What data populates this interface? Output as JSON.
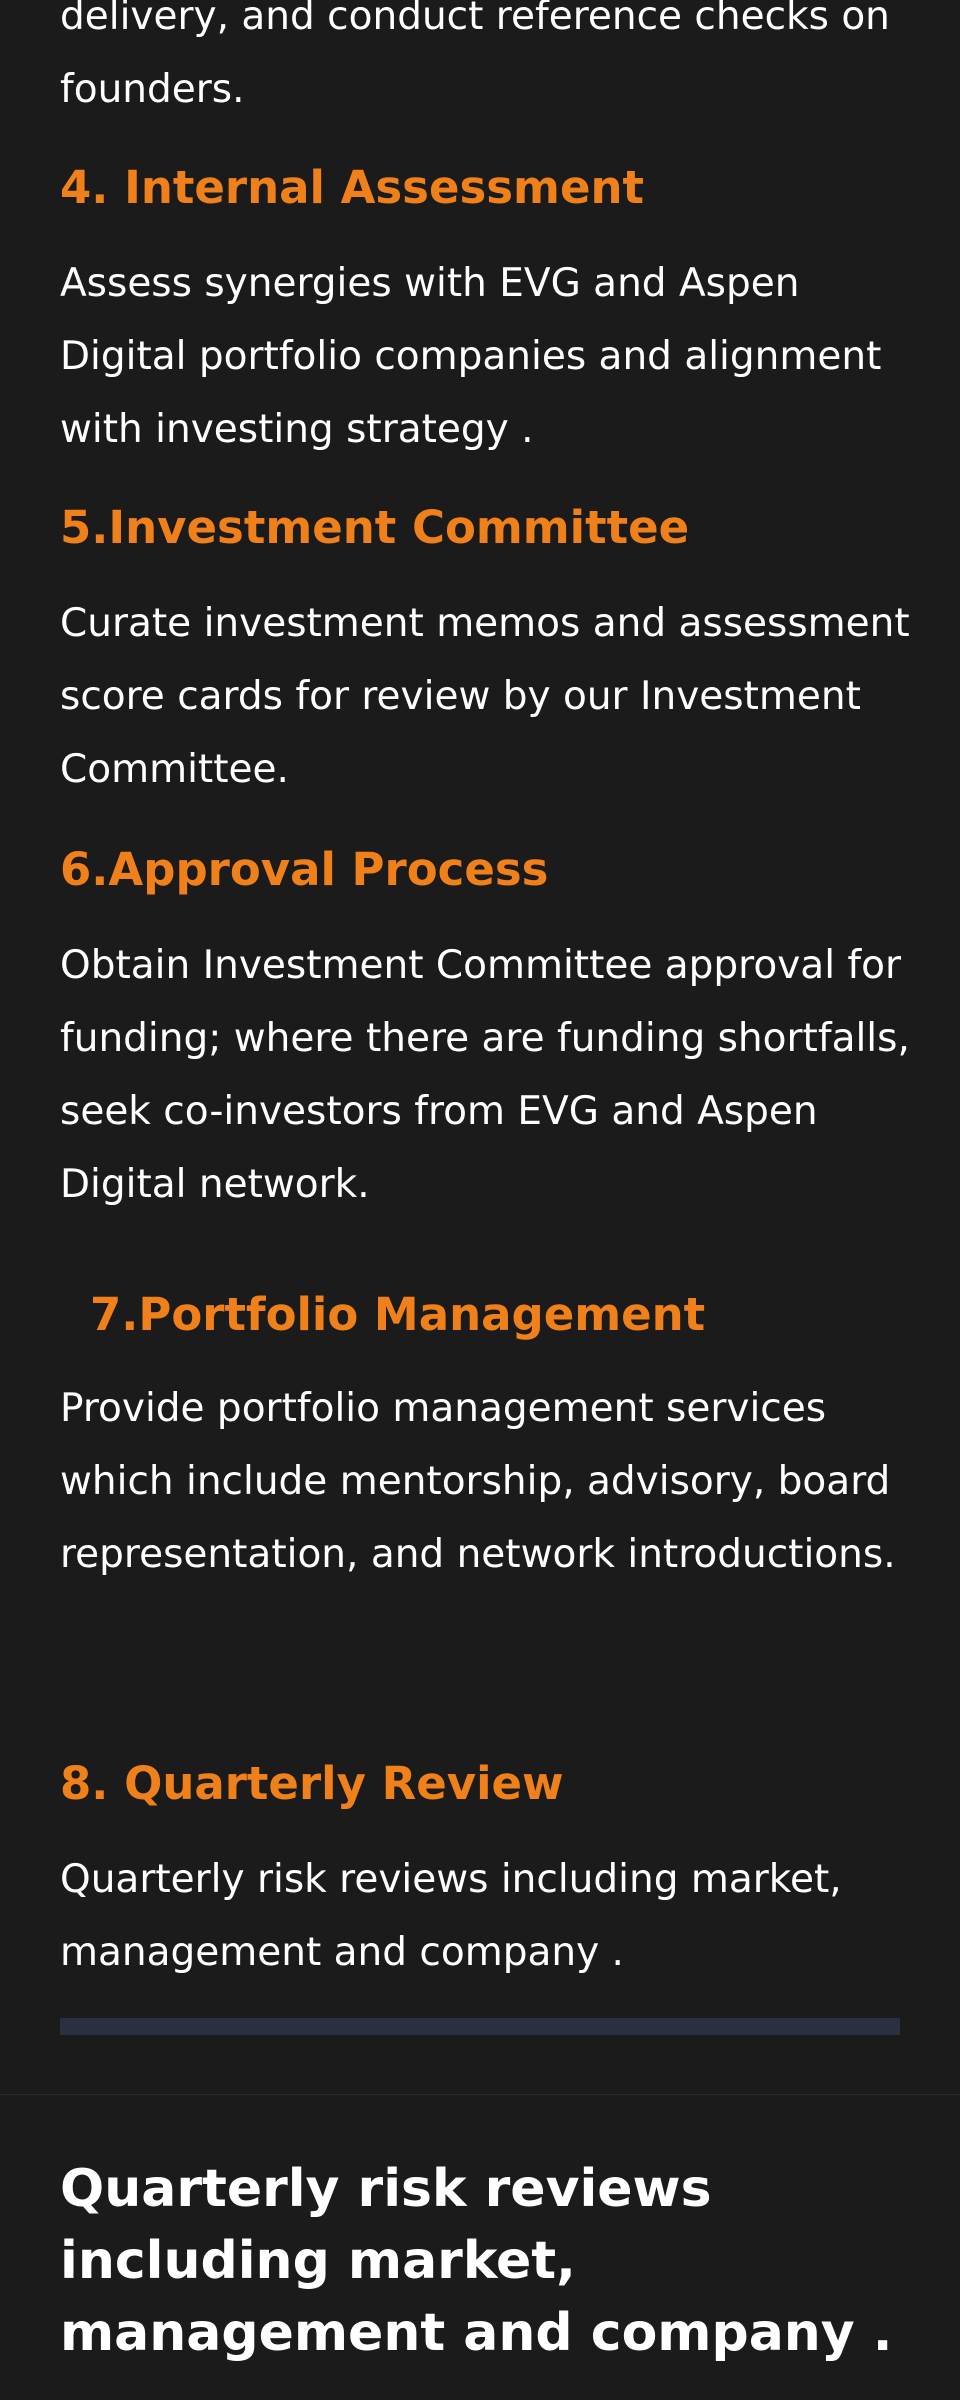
{
  "s3": {
    "tail_text": "delivery, and conduct reference checks on founders."
  },
  "s4": {
    "heading": "4. Internal Assessment",
    "text": "Assess synergies with EVG and Aspen Digital portfolio companies and alignment with investing strategy ."
  },
  "s5": {
    "heading": "5.Investment Committee",
    "text": "Curate investment memos and assessment score cards for review by our Investment Committee."
  },
  "s6": {
    "heading": "6.Approval Process",
    "text": "Obtain Investment Committee approval for funding; where there are funding shortfalls, seek co-investors from EVG and Aspen Digital network."
  },
  "s7": {
    "heading": "7.Portfolio Management",
    "text": "Provide portfolio management services which include mentorship, advisory, board representation, and network introductions."
  },
  "s8": {
    "heading": "8. Quarterly Review",
    "text": "Quarterly risk reviews including market, management and company ."
  },
  "callout": {
    "text": "Quarterly risk reviews including market, management and company ."
  },
  "colors": {
    "accent": "#f0811a",
    "background": "#1b1b1b",
    "text": "#ffffff",
    "bar": "#2b3040"
  }
}
